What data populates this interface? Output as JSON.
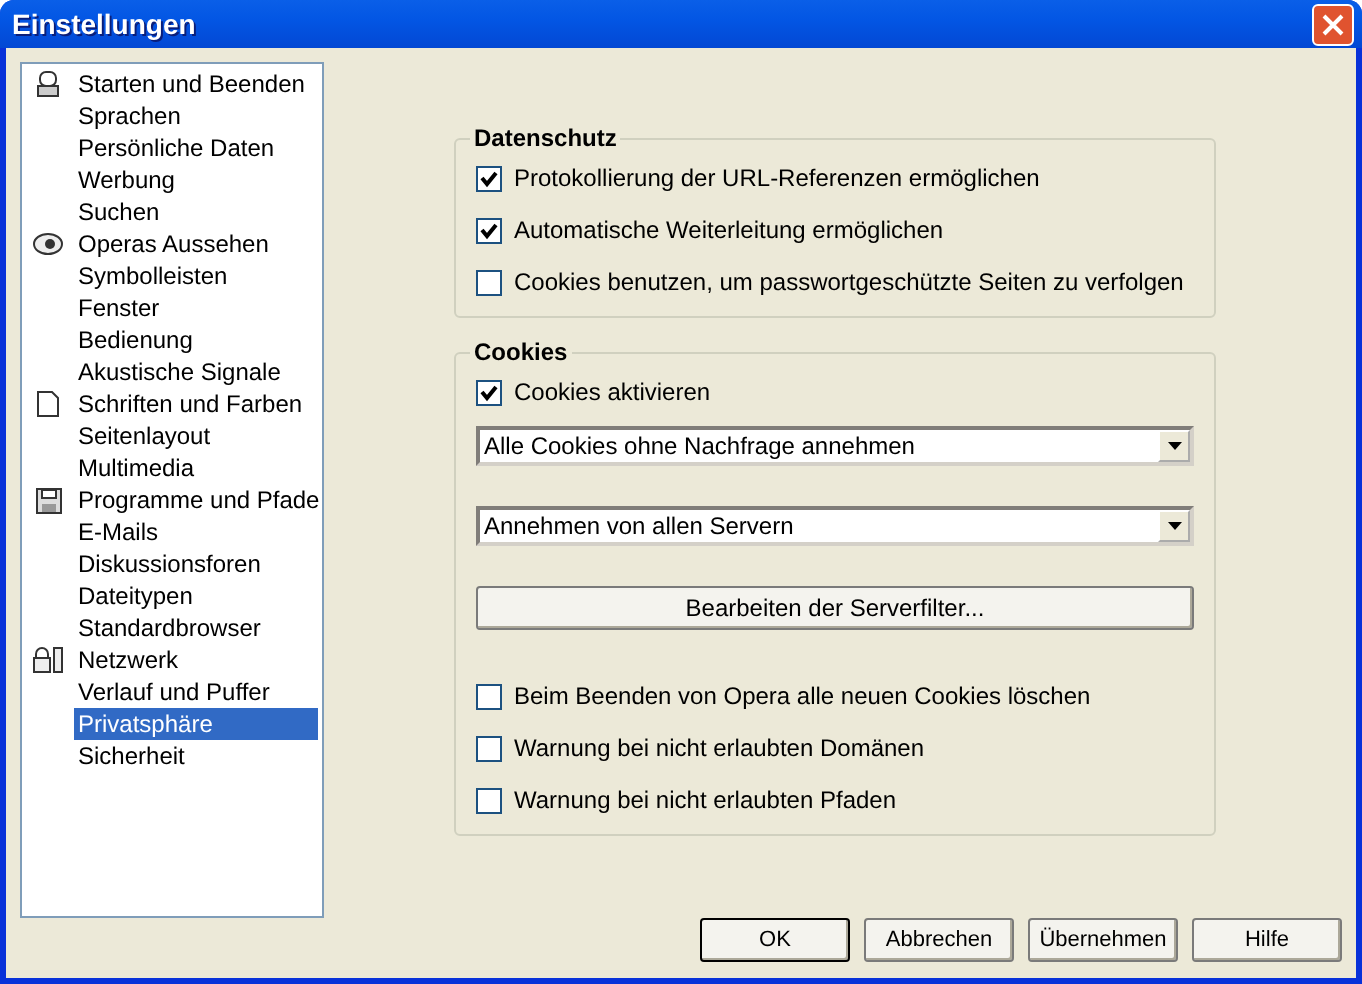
{
  "window": {
    "title": "Einstellungen"
  },
  "sidebar": {
    "groups": [
      {
        "items": [
          {
            "label": "Starten und Beenden",
            "selected": false
          },
          {
            "label": "Sprachen",
            "selected": false
          },
          {
            "label": "Persönliche Daten",
            "selected": false
          },
          {
            "label": "Werbung",
            "selected": false
          },
          {
            "label": "Suchen",
            "selected": false
          }
        ]
      },
      {
        "items": [
          {
            "label": "Operas Aussehen",
            "selected": false
          },
          {
            "label": "Symbolleisten",
            "selected": false
          },
          {
            "label": "Fenster",
            "selected": false
          },
          {
            "label": "Bedienung",
            "selected": false
          },
          {
            "label": "Akustische Signale",
            "selected": false
          }
        ]
      },
      {
        "items": [
          {
            "label": "Schriften und Farben",
            "selected": false
          },
          {
            "label": "Seitenlayout",
            "selected": false
          },
          {
            "label": "Multimedia",
            "selected": false
          }
        ]
      },
      {
        "items": [
          {
            "label": "Programme und Pfade",
            "selected": false
          },
          {
            "label": "E-Mails",
            "selected": false
          },
          {
            "label": "Diskussionsforen",
            "selected": false
          },
          {
            "label": "Dateitypen",
            "selected": false
          },
          {
            "label": "Standardbrowser",
            "selected": false
          }
        ]
      },
      {
        "items": [
          {
            "label": "Netzwerk",
            "selected": false
          },
          {
            "label": "Verlauf und Puffer",
            "selected": false
          },
          {
            "label": "Privatsphäre",
            "selected": true
          },
          {
            "label": "Sicherheit",
            "selected": false
          }
        ]
      }
    ]
  },
  "sections": [
    {
      "title": "Datenschutz",
      "controls": [
        {
          "kind": "checkbox",
          "label": "Protokollierung der URL-Referenzen ermöglichen",
          "checked": true
        },
        {
          "kind": "checkbox",
          "label": "Automatische Weiterleitung ermöglichen",
          "checked": true
        },
        {
          "kind": "checkbox",
          "label": "Cookies benutzen, um passwortgeschützte Seiten zu verfolgen",
          "checked": false
        }
      ]
    },
    {
      "title": "Cookies",
      "controls": [
        {
          "kind": "checkbox",
          "label": "Cookies aktivieren",
          "checked": true
        },
        {
          "kind": "dropdown",
          "value": "Alle Cookies ohne Nachfrage annehmen"
        },
        {
          "kind": "dropdown",
          "value": "Annehmen von allen Servern"
        },
        {
          "kind": "button",
          "label": "Bearbeiten der Serverfilter..."
        },
        {
          "kind": "checkbox",
          "label": "Beim Beenden von Opera alle neuen Cookies löschen",
          "checked": false
        },
        {
          "kind": "checkbox",
          "label": "Warnung bei nicht erlaubten Domänen",
          "checked": false
        },
        {
          "kind": "checkbox",
          "label": "Warnung bei nicht erlaubten Pfaden",
          "checked": false
        }
      ]
    }
  ],
  "buttons": [
    {
      "label": "OK",
      "default": true
    },
    {
      "label": "Abbrechen",
      "default": false
    },
    {
      "label": "Übernehmen",
      "default": false
    },
    {
      "label": "Hilfe",
      "default": false
    }
  ]
}
